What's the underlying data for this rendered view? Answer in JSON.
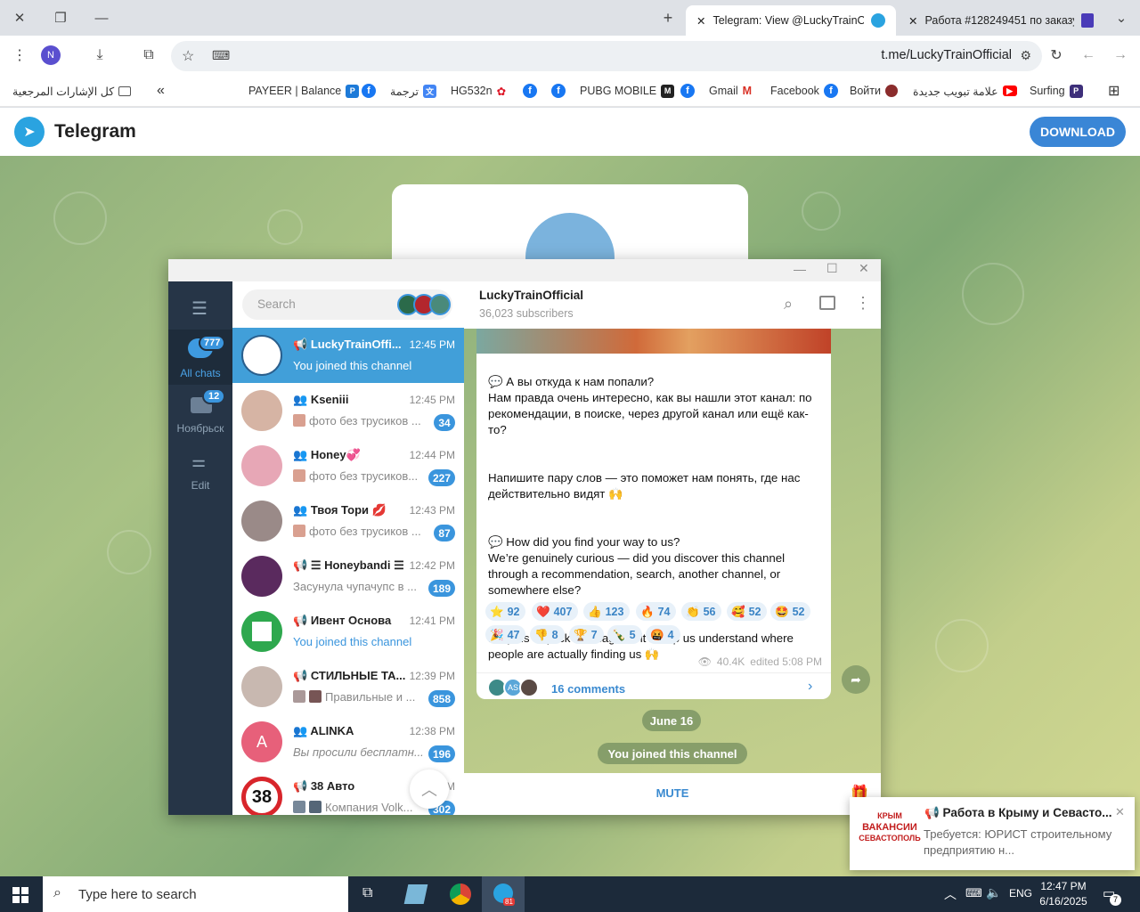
{
  "browser": {
    "tabs": [
      {
        "title": "Telegram: View @LuckyTrainOffi"
      },
      {
        "title": "Работа #128249451 по заказу"
      }
    ],
    "url": "t.me/LuckyTrainOfficial",
    "profile_initial": "N",
    "bookmarks": [
      "كل الإشارات المرجعية",
      "PAYEER | Balance",
      "ترجمة",
      "HG532n",
      "PUBG MOBILE",
      "Gmail",
      "Facebook",
      "Войти",
      "علامة تبويب جديدة",
      "Surfing"
    ]
  },
  "page": {
    "brand": "Telegram",
    "download_label": "DOWNLOAD"
  },
  "app": {
    "search_placeholder": "Search",
    "folders": [
      {
        "label": "All chats",
        "badge": "777"
      },
      {
        "label": "Ноябрьск",
        "badge": "12"
      },
      {
        "label": "Edit",
        "badge": ""
      }
    ],
    "chats": [
      {
        "name": "LuckyTrainOffi...",
        "time": "12:45 PM",
        "msg": "You joined this channel",
        "badge": "",
        "type": "channel"
      },
      {
        "name": "Kseniii",
        "time": "12:45 PM",
        "msg": "фото без трусиков ...",
        "badge": "34",
        "type": "group"
      },
      {
        "name": "Honey💞",
        "time": "12:44 PM",
        "msg": "фото без трусиков...",
        "badge": "227",
        "type": "group"
      },
      {
        "name": "Твоя Тори 💋",
        "time": "12:43 PM",
        "msg": "фото без трусиков ...",
        "badge": "87",
        "type": "group"
      },
      {
        "name": "☰ Honeybandi ☰",
        "time": "12:42 PM",
        "msg": "Засунула чупачупс в ...",
        "badge": "189",
        "type": "channel"
      },
      {
        "name": "Ивент Основа",
        "time": "12:41 PM",
        "msg": "You joined this channel",
        "badge": "",
        "type": "channel"
      },
      {
        "name": "СТИЛЬНЫЕ ТА...",
        "time": "12:39 PM",
        "msg": "Правильные и ...",
        "badge": "858",
        "type": "channel"
      },
      {
        "name": "ALINKA",
        "time": "12:38 PM",
        "msg": "Вы просили бесплатн...",
        "badge": "196",
        "type": "group"
      },
      {
        "name": "38 Авто",
        "time": "1 M",
        "msg": "Компания Volk...",
        "badge": "302",
        "type": "channel"
      }
    ],
    "channel": {
      "title": "LuckyTrainOfficial",
      "subscribers": "36,023 subscribers"
    },
    "message": {
      "paragraphs": [
        "💬 А вы откуда к нам попали?\nНам правда очень интересно, как вы нашли этот канал: по рекомендации, в поиске, через другой канал или ещё как-то?",
        "Напишите пару слов — это поможет нам понять, где нас действительно видят 🙌",
        "💬 How did you find your way to us?\nWe’re genuinely curious — did you discover this channel through a recommendation, search, another channel, or somewhere else?",
        "Drop us a quick message — it’ll help us understand where people are actually finding us 🙌"
      ],
      "reactions": [
        {
          "emoji": "⭐",
          "count": "92"
        },
        {
          "emoji": "❤️",
          "count": "407"
        },
        {
          "emoji": "👍",
          "count": "123"
        },
        {
          "emoji": "🔥",
          "count": "74"
        },
        {
          "emoji": "👏",
          "count": "56"
        },
        {
          "emoji": "🥰",
          "count": "52"
        },
        {
          "emoji": "🤩",
          "count": "52"
        },
        {
          "emoji": "🎉",
          "count": "47"
        },
        {
          "emoji": "👎",
          "count": "8"
        },
        {
          "emoji": "🏆",
          "count": "7"
        },
        {
          "emoji": "🍾",
          "count": "5"
        },
        {
          "emoji": "🤬",
          "count": "4"
        }
      ],
      "views": "40.4K",
      "edited": "edited 5:08 PM",
      "comments": "16 comments",
      "avatar_initials": "AS"
    },
    "date_pill": "June 16",
    "service_msg": "You joined this channel",
    "mute_label": "MUTE"
  },
  "notification": {
    "title": "📢 Работа в Крыму и Севасто...",
    "body": "Требуется: ЮРИСТ строительному предприятию н...",
    "logo_lines": [
      "КРЫМ",
      "ВАКАНСИИ",
      "СЕВАСТОПОЛЬ"
    ]
  },
  "taskbar": {
    "search_placeholder": "Type here to search",
    "lang": "ENG",
    "time": "12:47 PM",
    "date": "6/16/2025",
    "notif_count": "7",
    "tg_badge": "81"
  }
}
